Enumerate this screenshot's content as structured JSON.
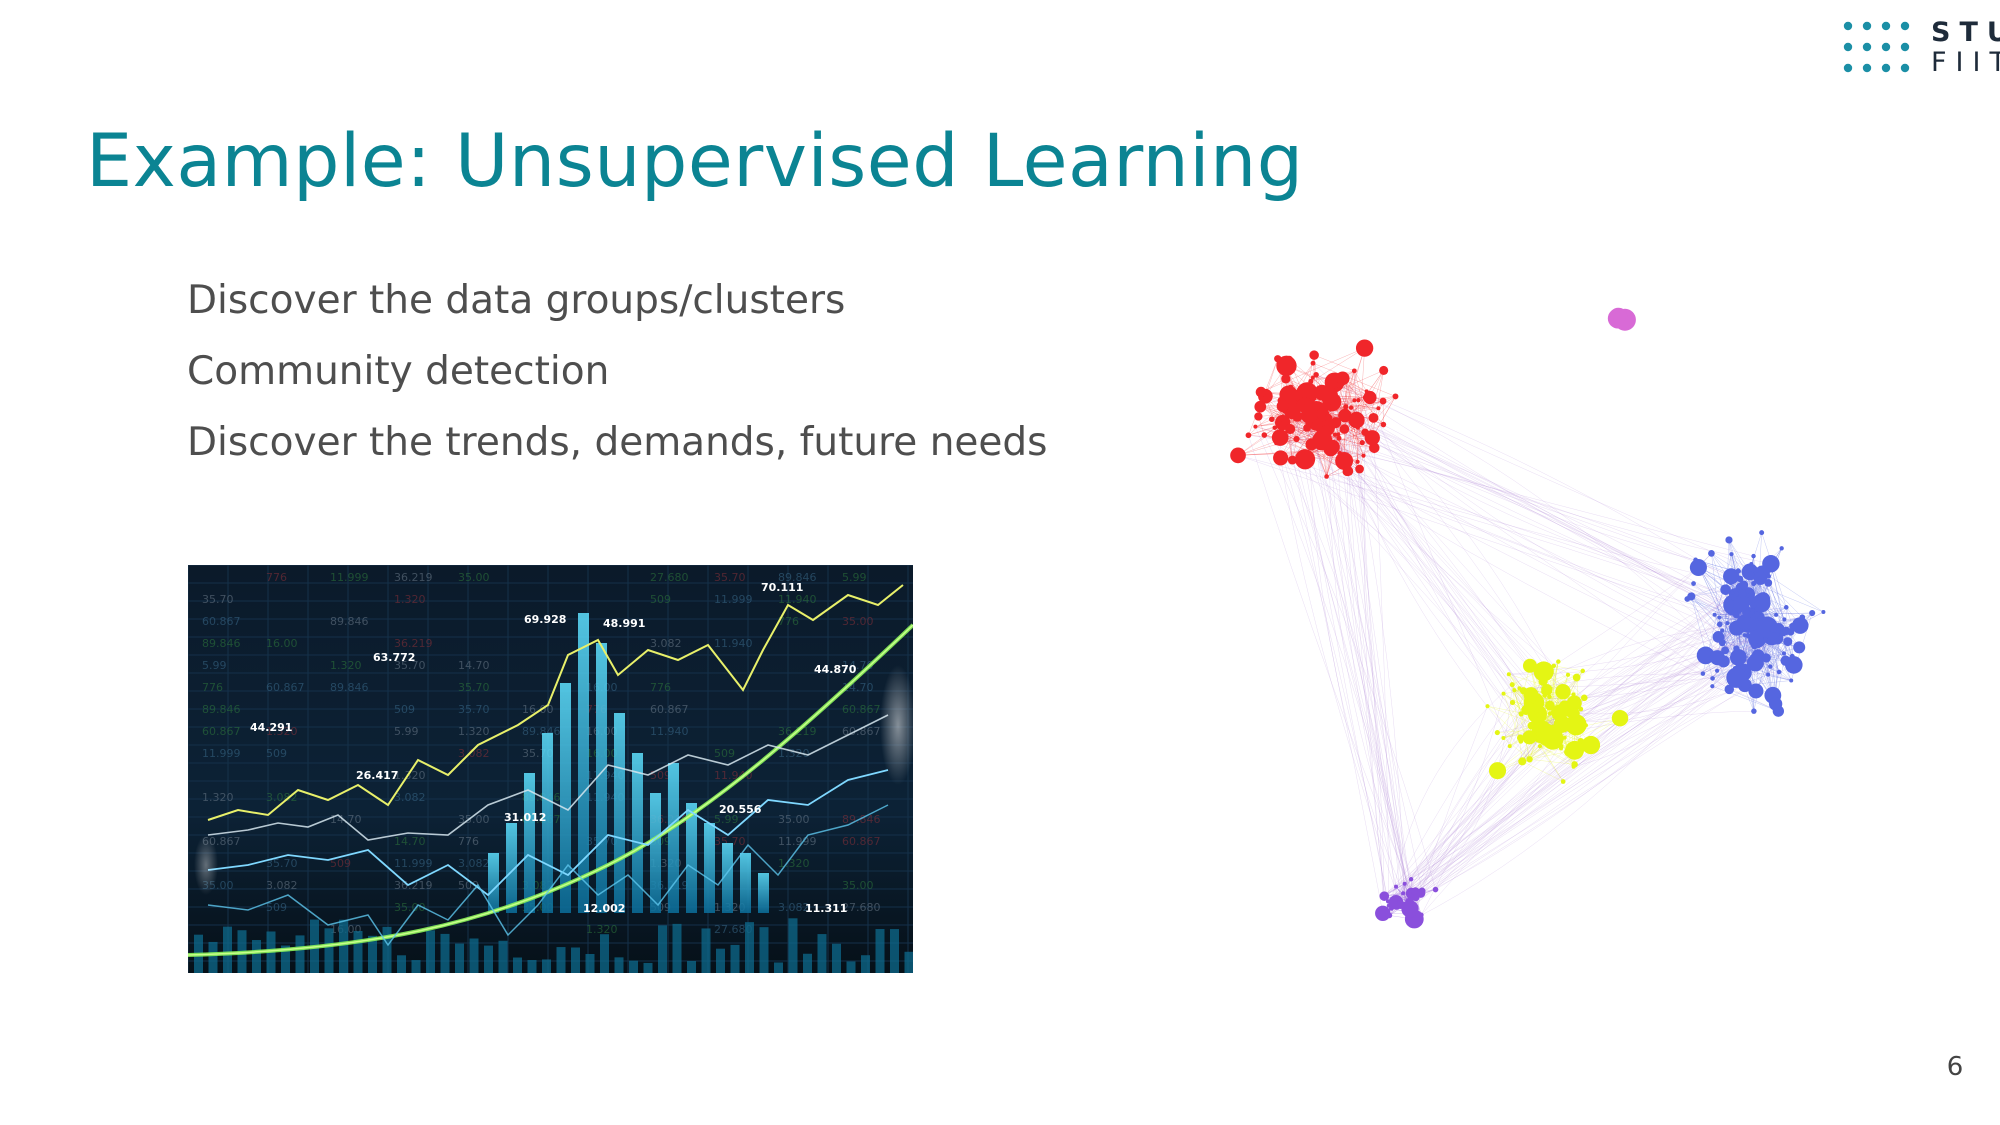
{
  "slide": {
    "title": "Example: Unsupervised Learning",
    "bullets": [
      "Discover the data groups/clusters",
      "Community detection",
      "Discover the trends, demands, future needs"
    ],
    "page_number": "6"
  },
  "logo": {
    "line1": "STU",
    "line2": "FIIT",
    "color": "#1b8fa6"
  },
  "colors": {
    "title": "#0b8493",
    "body_text": "#4e4e4e",
    "background": "#ffffff"
  },
  "stock_image": {
    "labels": [
      "70.111",
      "69.928",
      "48.991",
      "63.772",
      "44.870",
      "44.291",
      "26.417",
      "31.012",
      "20.556",
      "12.002",
      "11.311"
    ],
    "table_values": [
      "27.680",
      "3.082",
      "1.320",
      "776",
      "11.999",
      "60.867",
      "11.940",
      "89.846",
      "36.219",
      "5.99",
      "509",
      "14.70",
      "35.00",
      "35.70",
      "16.00"
    ]
  },
  "network_image": {
    "cluster_colors": {
      "red": "#f0262a",
      "blue": "#5566e0",
      "yellow": "#e4f514",
      "purple": "#8a4fdc",
      "pink": "#d86ad6"
    }
  }
}
